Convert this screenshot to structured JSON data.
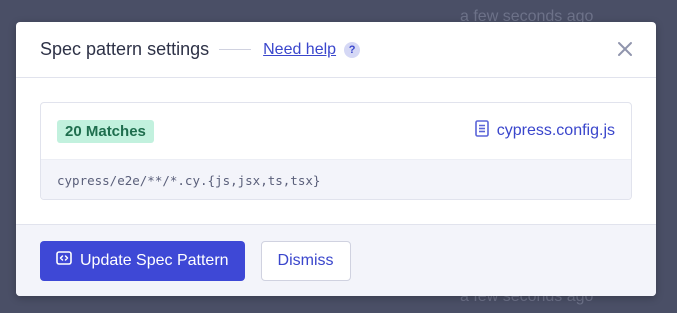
{
  "background": {
    "top_text": "a few seconds ago",
    "bottom_text": "a few seconds ago"
  },
  "modal": {
    "title": "Spec pattern settings",
    "help_link": "Need help",
    "help_icon": "?",
    "close_icon": "close-icon"
  },
  "match": {
    "badge": "20 Matches",
    "config_file": "cypress.config.js",
    "pattern": "cypress/e2e/**/*.cy.{js,jsx,ts,tsx}"
  },
  "footer": {
    "primary_label": "Update Spec Pattern",
    "secondary_label": "Dismiss"
  },
  "colors": {
    "accent": "#3e48d6",
    "badge_bg": "#c2f1de",
    "badge_text": "#1f6e4e",
    "overlay": "#4a4f66"
  }
}
